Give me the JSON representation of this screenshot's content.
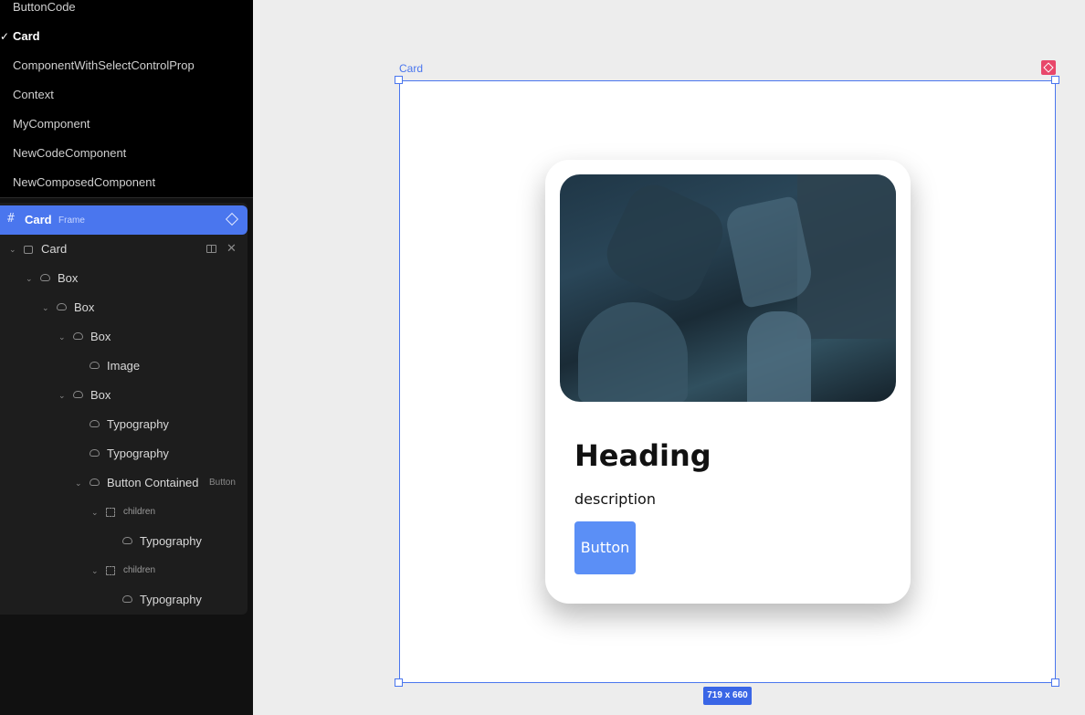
{
  "components": [
    {
      "label": "ButtonCode",
      "active": false
    },
    {
      "label": "Card",
      "active": true
    },
    {
      "label": "ComponentWithSelectControlProp",
      "active": false
    },
    {
      "label": "Context",
      "active": false
    },
    {
      "label": "MyComponent",
      "active": false
    },
    {
      "label": "NewCodeComponent",
      "active": false
    },
    {
      "label": "NewComposedComponent",
      "active": false
    }
  ],
  "check_mark": "✓",
  "frame": {
    "name": "Card",
    "type": "Frame",
    "hash": "#"
  },
  "layers": [
    {
      "label": "Card",
      "sub": ""
    },
    {
      "label": "Box",
      "sub": ""
    },
    {
      "label": "Box",
      "sub": ""
    },
    {
      "label": "Box",
      "sub": ""
    },
    {
      "label": "Image",
      "sub": ""
    },
    {
      "label": "Box",
      "sub": ""
    },
    {
      "label": "Typography",
      "sub": ""
    },
    {
      "label": "Typography",
      "sub": ""
    },
    {
      "label": "Button Contained",
      "sub": "Button"
    },
    {
      "label": "children",
      "sub": ""
    },
    {
      "label": "Typography",
      "sub": ""
    },
    {
      "label": "children",
      "sub": ""
    },
    {
      "label": "Typography",
      "sub": ""
    }
  ],
  "canvas": {
    "frame_label": "Card",
    "size_badge": "719 x 660",
    "accent_color": "#4a76ee",
    "card": {
      "heading": "Heading",
      "description": "description",
      "button_label": "Button"
    }
  }
}
